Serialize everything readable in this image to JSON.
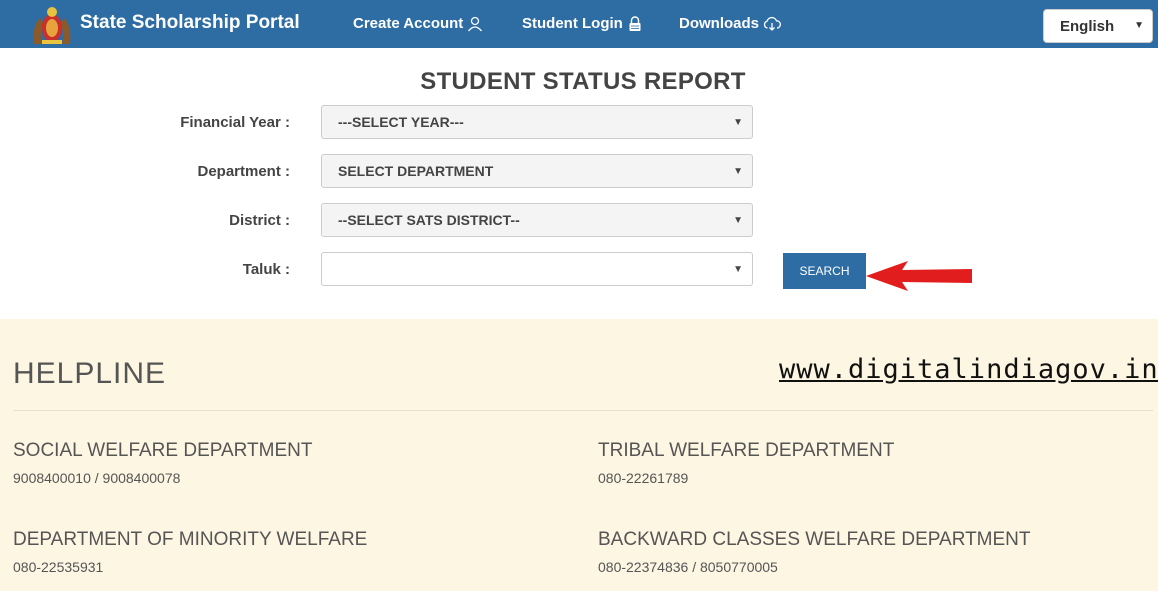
{
  "header": {
    "brand": "State Scholarship Portal",
    "nav": [
      {
        "label": "Create Account",
        "icon": "user-icon"
      },
      {
        "label": "Student Login",
        "icon": "lock-icon"
      },
      {
        "label": "Downloads",
        "icon": "cloud-download-icon"
      }
    ],
    "language": "English",
    "colors": {
      "navbar": "#2e6da4"
    }
  },
  "page_title": "STUDENT STATUS REPORT",
  "form": {
    "financial_year": {
      "label": "Financial Year :",
      "value": "---SELECT YEAR---"
    },
    "department": {
      "label": "Department :",
      "value": "SELECT DEPARTMENT"
    },
    "district": {
      "label": "District :",
      "value": "--SELECT SATS DISTRICT--"
    },
    "taluk": {
      "label": "Taluk :",
      "value": ""
    },
    "search_label": "SEARCH"
  },
  "helpline": {
    "title": "HELPLINE",
    "watermark": "www.digitalindiagov.in",
    "departments": [
      {
        "name": "SOCIAL WELFARE DEPARTMENT",
        "phone": "9008400010 / 9008400078"
      },
      {
        "name": "TRIBAL WELFARE DEPARTMENT",
        "phone": "080-22261789"
      },
      {
        "name": "DEPARTMENT OF MINORITY WELFARE",
        "phone": "080-22535931"
      },
      {
        "name": "BACKWARD CLASSES WELFARE DEPARTMENT",
        "phone": "080-22374836 / 8050770005"
      }
    ]
  }
}
